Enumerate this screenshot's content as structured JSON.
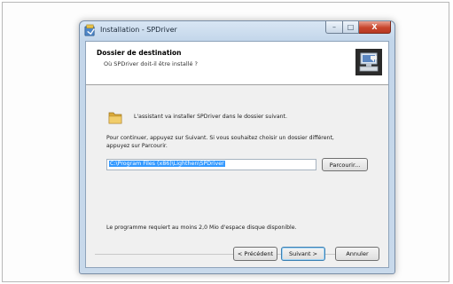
{
  "window": {
    "title": "Installation - SPDriver",
    "title_buttons": {
      "minimize": "–",
      "maximize": "□",
      "close": "X"
    }
  },
  "header": {
    "title": "Dossier de destination",
    "subtitle": "Où SPDriver doit-il être installé ?"
  },
  "body": {
    "intro": "L'assistant va installer SPDriver dans le dossier suivant.",
    "instructions_line1": "Pour continuer, appuyez sur Suivant. Si vous souhaitez choisir un dossier différent,",
    "instructions_line2": "appuyez sur Parcourir.",
    "path_value": "C:\\Program Files (x86)\\Lighthen\\SPDriver",
    "browse_label": "Parcourir...",
    "space_note": "Le programme requiert au moins 2,0 Mio d'espace disque disponible."
  },
  "footer": {
    "back_label": "< Précédent",
    "next_label": "Suivant >",
    "cancel_label": "Annuler"
  },
  "icons": {
    "app": "installer-icon",
    "header": "computer-install-icon",
    "folder": "folder-icon"
  },
  "colors": {
    "selection": "#3399ff",
    "close_button": "#c8462d",
    "title_gradient": "#c3d6ea"
  }
}
